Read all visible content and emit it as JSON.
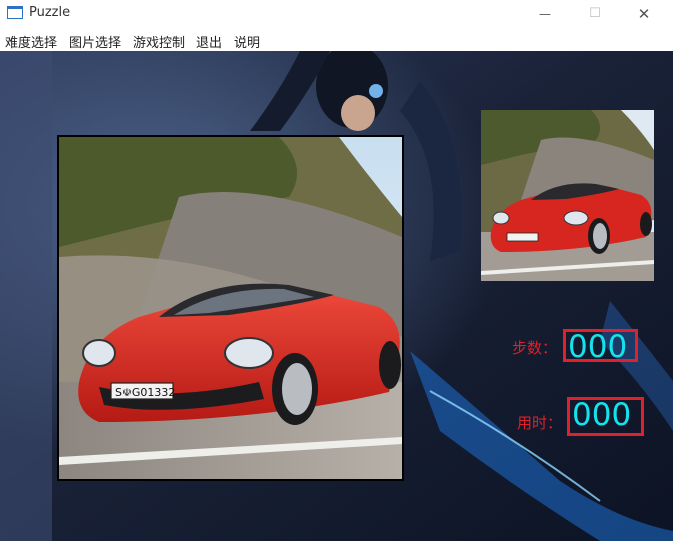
{
  "window": {
    "title": "Puzzle",
    "minimize_glyph": "—",
    "maximize_glyph": "☐",
    "close_glyph": "✕"
  },
  "menu": {
    "items": [
      "难度选择",
      "图片选择",
      "游戏控制",
      "退出",
      "说明"
    ]
  },
  "stats": {
    "steps_label": "步数：",
    "steps_value": "000",
    "time_label": "用时：",
    "time_value": "000"
  },
  "colors": {
    "accent_red": "#e0202a",
    "counter_cyan": "#14e3ee",
    "car_red": "#d7261f"
  },
  "icons": {
    "app": "window-icon",
    "minimize": "minimize-icon",
    "maximize": "maximize-icon",
    "close": "close-icon"
  }
}
